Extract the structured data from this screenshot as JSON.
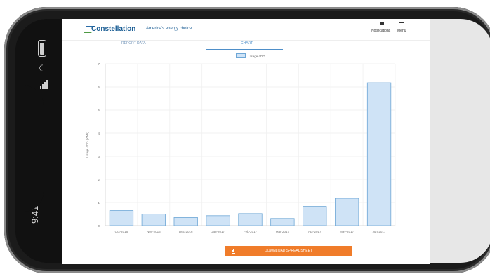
{
  "phone": {
    "time": "9:41"
  },
  "header": {
    "logo_text": "Constellation",
    "tagline": "America's energy choice.",
    "notifications_label": "Notifications",
    "menu_label": "Menu"
  },
  "tabs": [
    {
      "label": "REPORT DATA"
    },
    {
      "label": "CHART"
    }
  ],
  "actions": {
    "download_label": "DOWNLOAD SPREADSHEET"
  },
  "chart_data": {
    "type": "bar",
    "categories": [
      "Oct-2016",
      "Nov-2016",
      "Dec-2016",
      "Jan-2017",
      "Feb-2017",
      "Mar-2017",
      "Apr-2017",
      "May-2017",
      "Jun-2017"
    ],
    "series": [
      {
        "name": "Usage / DD",
        "values": [
          0.65,
          0.5,
          0.35,
          0.43,
          0.52,
          0.31,
          0.83,
          1.18,
          6.18
        ]
      }
    ],
    "title": "",
    "xlabel": "",
    "ylabel": "Usage / DD (kWh)",
    "ylim": [
      0,
      7
    ],
    "yticks": [
      0,
      1,
      2,
      3,
      4,
      5,
      6,
      7
    ],
    "grid": true,
    "legend_position": "top-center",
    "bar_color": "#cfe3f6",
    "bar_border": "#6ea7d6"
  }
}
